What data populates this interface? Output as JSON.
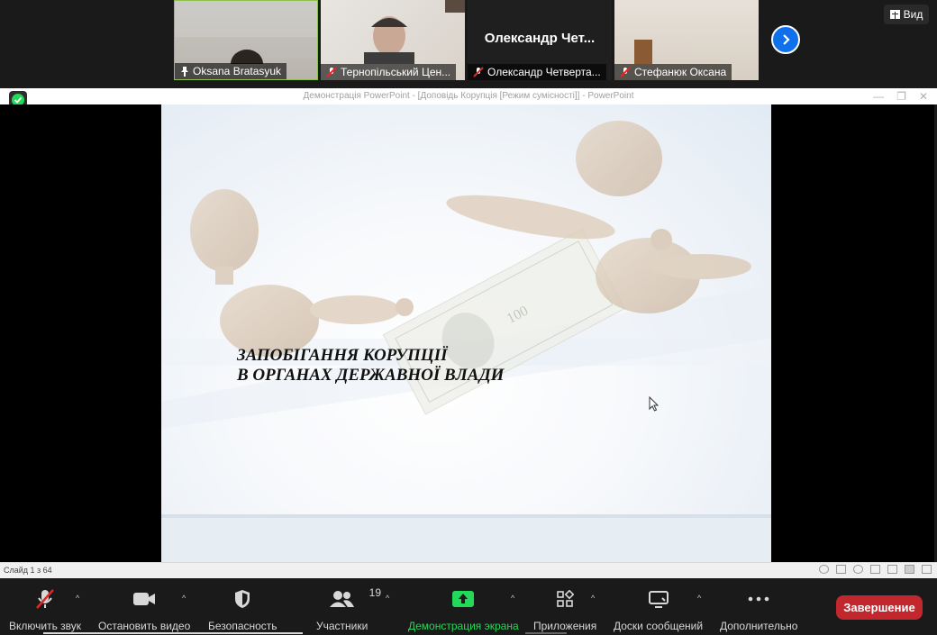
{
  "participants_strip": {
    "tiles": [
      {
        "name": "Oksana Bratasyuk"
      },
      {
        "name": "Тернопільський Цен..."
      },
      {
        "name": "Олександр Четверта...",
        "display_name": "Олександр  Чет..."
      },
      {
        "name": "Стефанюк Оксана"
      }
    ],
    "view_label": "Вид"
  },
  "ppt": {
    "window_title": "Демонстрація PowerPoint - [Доповідь Корупція [Режим сумісності]] - PowerPoint",
    "slide_title_line1": "ЗАПОБІГАННЯ КОРУПЦІЇ",
    "slide_title_line2": "В ОРГАНАХ ДЕРЖАВНОЇ ВЛАДИ",
    "slide_counter": "Слайд 1 з 64"
  },
  "toolbar": {
    "unmute_label": "Включить звук",
    "video_label": "Остановить видео",
    "security_label": "Безопасность",
    "participants_label": "Участники",
    "participants_count": "19",
    "share_label": "Демонстрация экрана",
    "apps_label": "Приложения",
    "whiteboards_label": "Доски сообщений",
    "more_label": "Дополнительно",
    "end_label": "Завершение"
  },
  "colors": {
    "share_green": "#23d959",
    "end_red": "#c1272d",
    "accent_blue": "#0e71eb",
    "muted_red": "#e02828"
  }
}
